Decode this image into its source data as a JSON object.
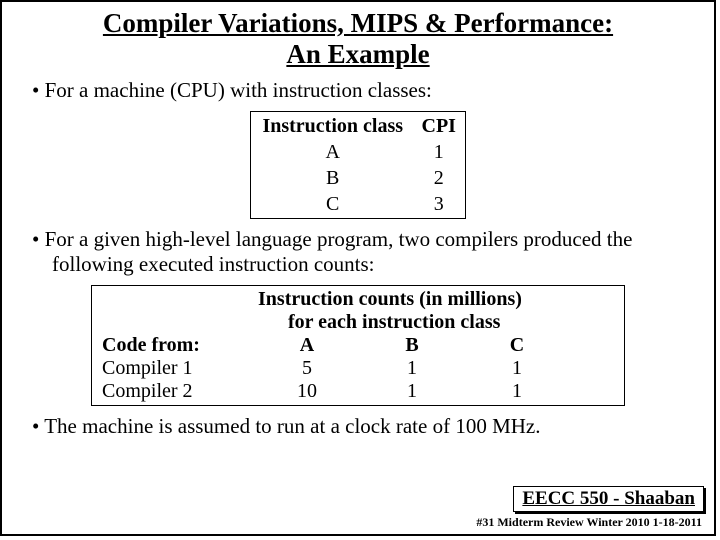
{
  "title_line1": "Compiler Variations, MIPS & Performance:",
  "title_line2": "An Example",
  "bullet1": "For a machine (CPU) with instruction classes:",
  "table1": {
    "header_col1": "Instruction class",
    "header_col2": "CPI",
    "rows": [
      {
        "cls": "A",
        "cpi": "1"
      },
      {
        "cls": "B",
        "cpi": "2"
      },
      {
        "cls": "C",
        "cpi": "3"
      }
    ]
  },
  "bullet2": "For a given high-level language program, two compilers produced the following executed instruction counts:",
  "table2": {
    "header_main": "Instruction counts (in millions)",
    "header_sub": "for each instruction class",
    "code_from": "Code  from:",
    "colA": "A",
    "colB": "B",
    "colC": "C",
    "rows": [
      {
        "label": "Compiler 1",
        "a": "5",
        "b": "1",
        "c": "1"
      },
      {
        "label": "Compiler 2",
        "a": "10",
        "b": "1",
        "c": "1"
      }
    ]
  },
  "bullet3": "The machine is assumed to run at a clock rate of 100 MHz.",
  "footer_box": "EECC 550 - Shaaban",
  "footer_note": "#31   Midterm Review  Winter 2010 1-18-2011"
}
